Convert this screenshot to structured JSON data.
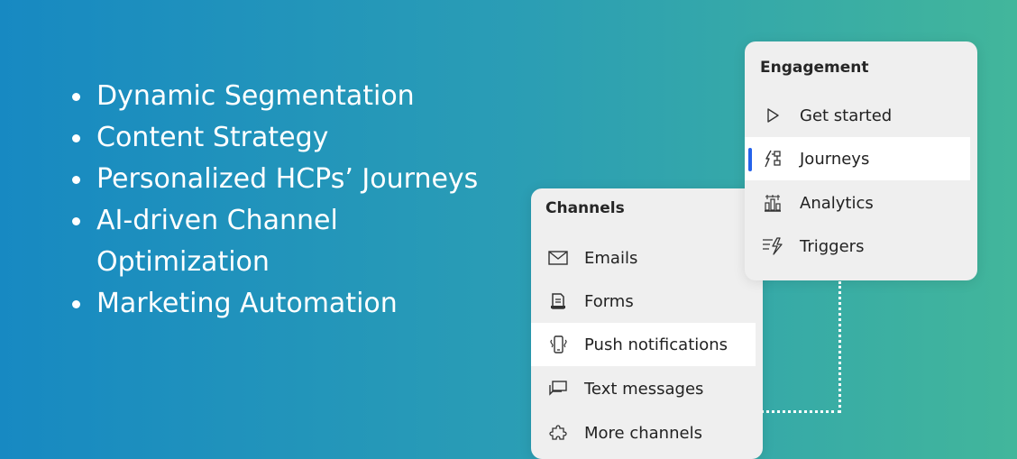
{
  "bullets": [
    "Dynamic Segmentation",
    "Content Strategy",
    "Personalized HCPs’ Journeys",
    "AI-driven Channel",
    "Optimization",
    "Marketing Automation"
  ],
  "channels_panel": {
    "title": "Channels",
    "items": [
      {
        "label": "Emails",
        "icon": "email-icon"
      },
      {
        "label": "Forms",
        "icon": "form-icon"
      },
      {
        "label": "Push notifications",
        "icon": "mobile-notification-icon",
        "selected": true
      },
      {
        "label": "Text messages",
        "icon": "chat-icon"
      },
      {
        "label": "More channels",
        "icon": "puzzle-icon"
      }
    ]
  },
  "engagement_panel": {
    "title": "Engagement",
    "items": [
      {
        "label": "Get started",
        "icon": "play-icon"
      },
      {
        "label": "Journeys",
        "icon": "journey-icon",
        "selected": true
      },
      {
        "label": "Analytics",
        "icon": "analytics-icon"
      },
      {
        "label": "Triggers",
        "icon": "trigger-icon"
      }
    ]
  },
  "colors": {
    "gradient_start": "#1789c2",
    "gradient_end": "#42b69b",
    "panel_bg": "#efefef",
    "selected_bg": "#ffffff",
    "selection_indicator": "#2563eb"
  }
}
